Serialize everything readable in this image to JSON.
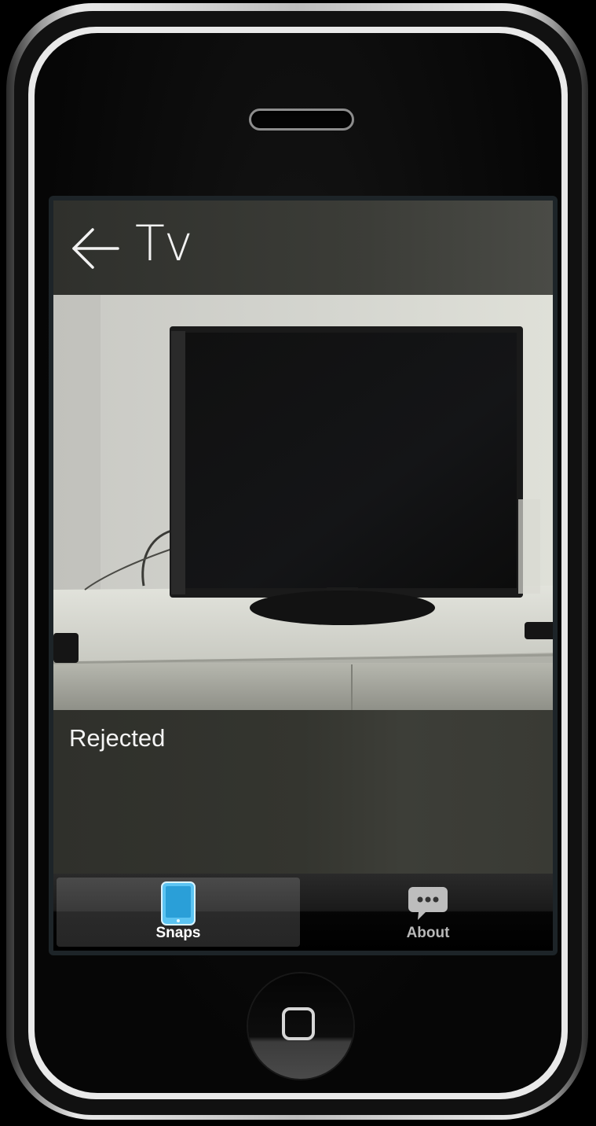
{
  "header": {
    "title": "Tv",
    "back_icon": "arrow-left-icon"
  },
  "photo": {
    "subject": "tv-photo"
  },
  "status": {
    "text": "Rejected"
  },
  "tabbar": {
    "tabs": [
      {
        "label": "Snaps",
        "icon": "tablet-icon",
        "active": true
      },
      {
        "label": "About",
        "icon": "speech-bubble-icon",
        "active": false
      }
    ]
  },
  "colors": {
    "accent": "#4fb6e8",
    "tab_active_bg": "#3a3a3a",
    "text": "#f4f4f4"
  }
}
